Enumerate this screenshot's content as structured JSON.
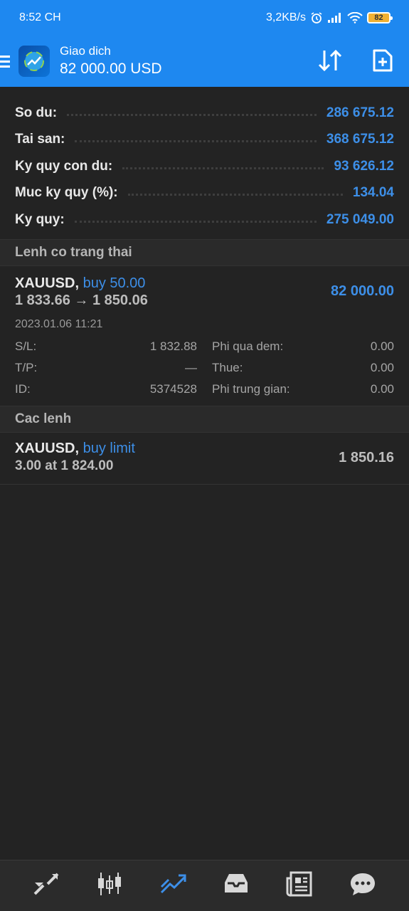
{
  "status_bar": {
    "time": "8:52 CH",
    "speed": "3,2KB/s",
    "battery": "82"
  },
  "toolbar": {
    "title": "Giao dich",
    "balance": "82 000.00 USD"
  },
  "summary": [
    {
      "label": "So du:",
      "value": "286 675.12"
    },
    {
      "label": "Tai san:",
      "value": "368 675.12"
    },
    {
      "label": "Ky quy con du:",
      "value": "93 626.12"
    },
    {
      "label": "Muc ky quy (%):",
      "value": "134.04"
    },
    {
      "label": "Ky quy:",
      "value": "275 049.00"
    }
  ],
  "positions_header": "Lenh co trang thai",
  "position": {
    "symbol": "XAUUSD,",
    "type": "buy 50.00",
    "prices": "1 833.66 → 1 850.06",
    "profit": "82 000.00",
    "time": "2023.01.06 11:21",
    "details": [
      {
        "k1": "S/L:",
        "v1": "1 832.88",
        "k2": "Phi qua dem:",
        "v2": "0.00"
      },
      {
        "k1": "T/P:",
        "v1": "—",
        "k2": "Thue:",
        "v2": "0.00"
      },
      {
        "k1": "ID:",
        "v1": "5374528",
        "k2": "Phi trung gian:",
        "v2": "0.00"
      }
    ]
  },
  "orders_header": "Cac lenh",
  "order": {
    "symbol": "XAUUSD,",
    "type": "buy limit",
    "sub": "3.00 at 1 824.00",
    "price": "1 850.16"
  },
  "colors": {
    "accent": "#1e88f0",
    "value_blue": "#3d8fe8",
    "background": "#232323"
  },
  "nav_icons": [
    "quotes-icon",
    "chart-icon",
    "trade-icon",
    "history-icon",
    "news-icon",
    "chat-icon"
  ]
}
